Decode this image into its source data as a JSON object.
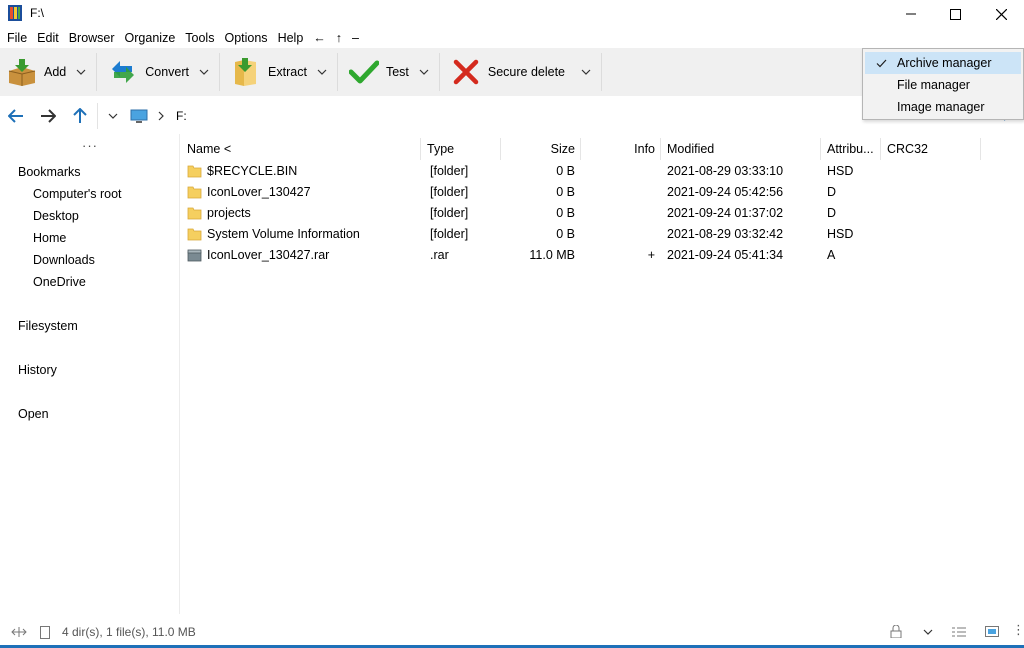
{
  "window": {
    "title": "F:\\"
  },
  "menu": [
    "File",
    "Edit",
    "Browser",
    "Organize",
    "Tools",
    "Options",
    "Help"
  ],
  "menu_nav": {
    "back": "←",
    "up": "↑",
    "minus": "–"
  },
  "toolbar": {
    "add": "Add",
    "convert": "Convert",
    "extract": "Extract",
    "test": "Test",
    "secure_delete": "Secure delete"
  },
  "address": {
    "path": "F:"
  },
  "sidebar": {
    "bookmarks_heading": "Bookmarks",
    "bookmarks": [
      "Computer's root",
      "Desktop",
      "Home",
      "Downloads",
      "OneDrive"
    ],
    "filesystem": "Filesystem",
    "history": "History",
    "open": "Open"
  },
  "columns": {
    "name": "Name <",
    "type": "Type",
    "size": "Size",
    "info": "Info",
    "modified": "Modified",
    "attributes": "Attribu...",
    "crc32": "CRC32"
  },
  "files": [
    {
      "name": "$RECYCLE.BIN",
      "type": "[folder]",
      "size": "0 B",
      "info": "",
      "modified": "2021-08-29 03:33:10",
      "attributes": "HSD",
      "icon": "folder-icon"
    },
    {
      "name": "IconLover_130427",
      "type": "[folder]",
      "size": "0 B",
      "info": "",
      "modified": "2021-09-24 05:42:56",
      "attributes": "D",
      "icon": "folder-icon"
    },
    {
      "name": "projects",
      "type": "[folder]",
      "size": "0 B",
      "info": "",
      "modified": "2021-09-24 01:37:02",
      "attributes": "D",
      "icon": "folder-icon"
    },
    {
      "name": "System Volume Information",
      "type": "[folder]",
      "size": "0 B",
      "info": "",
      "modified": "2021-08-29 03:32:42",
      "attributes": "HSD",
      "icon": "folder-icon"
    },
    {
      "name": "IconLover_130427.rar",
      "type": ".rar",
      "size": "11.0 MB",
      "info": "+",
      "modified": "2021-09-24 05:41:34",
      "attributes": "A",
      "icon": "archive-icon"
    }
  ],
  "status": {
    "summary": "4 dir(s), 1 file(s), 11.0 MB"
  },
  "view_menu": {
    "items": [
      {
        "label": "Archive manager",
        "checked": true
      },
      {
        "label": "File manager",
        "checked": false
      },
      {
        "label": "Image manager",
        "checked": false
      }
    ]
  },
  "colors": {
    "accent": "#1e70b8",
    "folder": "#f5cf5f",
    "check_green": "#2fa82f",
    "delete_red": "#d42a1e"
  }
}
